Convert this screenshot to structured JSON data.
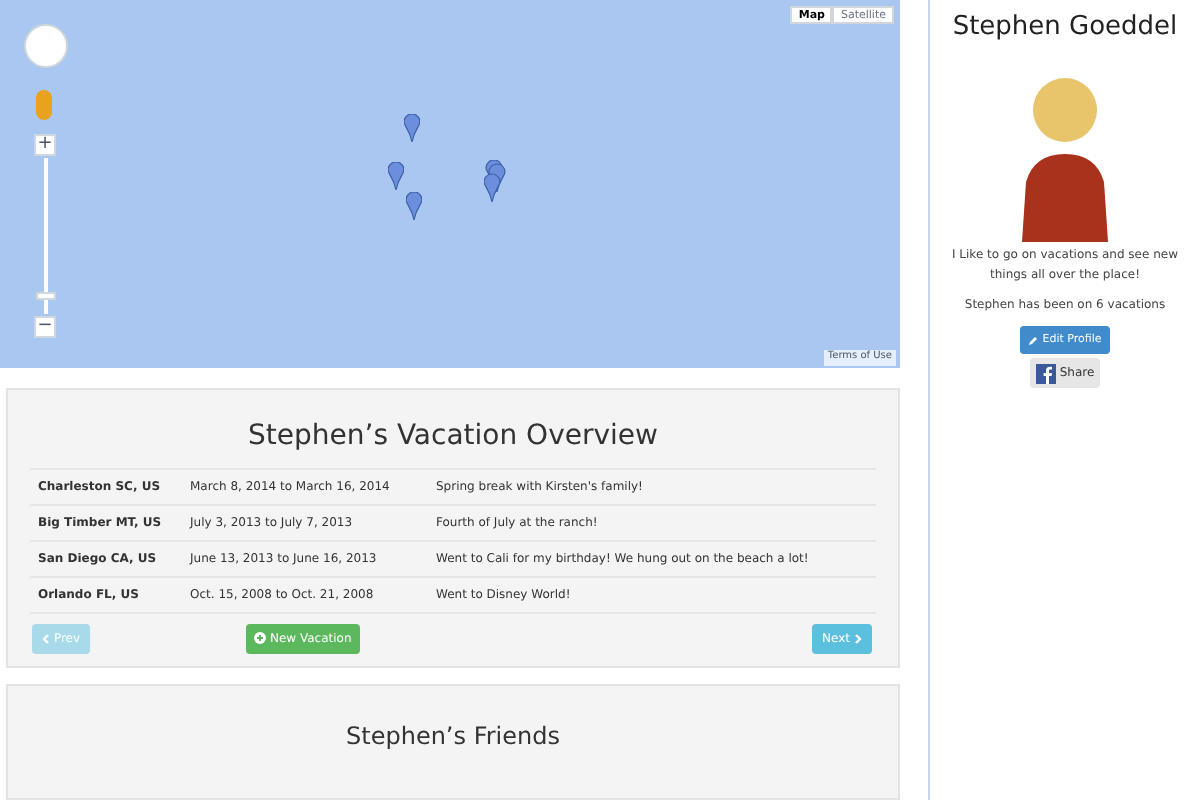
{
  "map": {
    "type_buttons": [
      {
        "label": "Map",
        "selected": true
      },
      {
        "label": "Satellite",
        "selected": false
      }
    ],
    "zoom_in": "+",
    "zoom_out": "−",
    "zoom_slider": {
      "level": 0.1
    },
    "terms": "Terms of Use"
  },
  "profile": {
    "name": "Stephen Goeddel",
    "bio": "I Like to go on vacations and see new things all over the place!",
    "count_text": "Stephen has been on 6 vacations",
    "edit_button": "Edit Profile",
    "share_button": "Share"
  },
  "vacations": {
    "title": "Stephen’s Vacation Overview",
    "rows": [
      {
        "place": "Charleston SC, US",
        "dates": "March 8, 2014 to March 16, 2014",
        "note": "Spring break with Kirsten's family!"
      },
      {
        "place": "Big Timber MT, US",
        "dates": "July 3, 2013 to July 7, 2013",
        "note": "Fourth of July at the ranch!"
      },
      {
        "place": "San Diego CA, US",
        "dates": "June 13, 2013 to June 16, 2013",
        "note": "Went to Cali for my birthday! We hung out on the beach a lot!"
      },
      {
        "place": "Orlando FL, US",
        "dates": "Oct. 15, 2008 to Oct. 21, 2008",
        "note": "Went to Disney World!"
      }
    ],
    "prev": {
      "label": "Prev",
      "disabled": true
    },
    "new_button": "New Vacation",
    "next": {
      "label": "Next",
      "disabled": false
    }
  },
  "friends": {
    "title": "Stephen’s Friends"
  }
}
